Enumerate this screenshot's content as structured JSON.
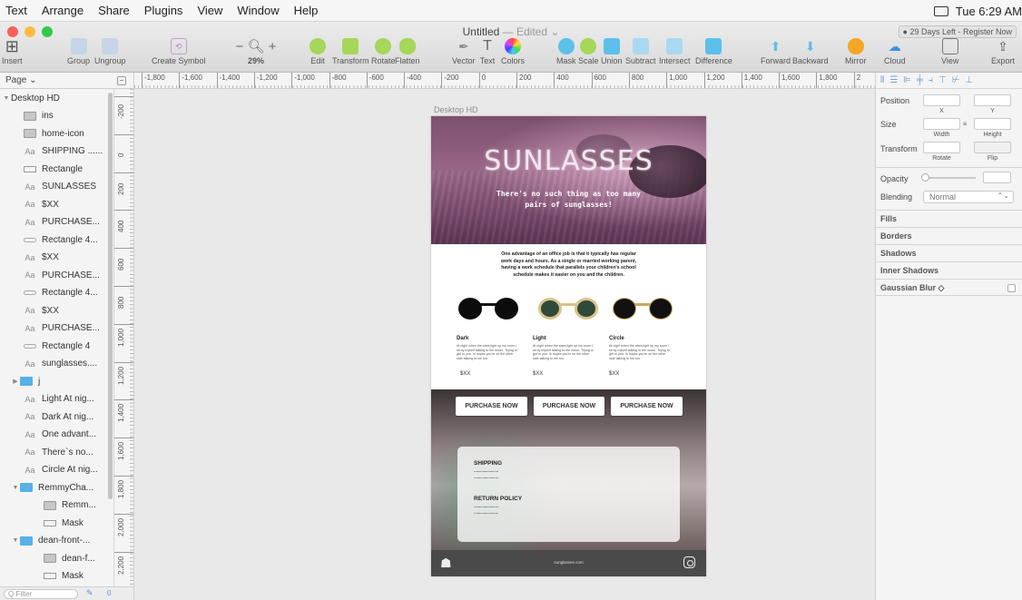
{
  "menubar": {
    "items": [
      "Text",
      "Arrange",
      "Share",
      "Plugins",
      "View",
      "Window",
      "Help"
    ],
    "clock": "Tue 6:29 AM"
  },
  "window": {
    "title": "Untitled",
    "edited": "— Edited ⌄",
    "trial": "● 29 Days Left - Register Now"
  },
  "toolbar": {
    "insert": "Insert",
    "group": "Group",
    "ungroup": "Ungroup",
    "create_symbol": "Create Symbol",
    "zoom": "29%",
    "edit": "Edit",
    "transform": "Transform",
    "rotate": "Rotate",
    "flatten": "Flatten",
    "vector": "Vector",
    "text": "Text",
    "colors": "Colors",
    "mask": "Mask",
    "scale": "Scale",
    "union": "Union",
    "subtract": "Subtract",
    "intersect": "Intersect",
    "difference": "Difference",
    "forward": "Forward",
    "backward": "Backward",
    "mirror": "Mirror",
    "cloud": "Cloud",
    "view": "View",
    "export": "Export",
    "zoom_minus": "−",
    "zoom_plus": "+",
    "text_glyph": "T"
  },
  "page_selector": "Page ⌄",
  "ruler": {
    "h_ticks": [
      "-1,800",
      "-1,600",
      "-1,400",
      "-1,200",
      "-1,000",
      "-800",
      "-600",
      "-400",
      "-200",
      "0",
      "200",
      "400",
      "600",
      "800",
      "1,000",
      "1,200",
      "1,400",
      "1,600",
      "1,800",
      "2"
    ],
    "v_ticks": [
      "-200",
      "0",
      "200",
      "400",
      "600",
      "800",
      "1,000",
      "1,200",
      "1,400",
      "1,600",
      "1,800",
      "2,000",
      "2,200"
    ]
  },
  "layers": [
    {
      "label": "Desktop HD",
      "icon": "artboard",
      "indent": 0,
      "tri": "▼"
    },
    {
      "label": "ins",
      "icon": "image",
      "indent": 1
    },
    {
      "label": "home-icon",
      "icon": "image",
      "indent": 1
    },
    {
      "label": "SHIPPING ......",
      "icon": "text",
      "indent": 1
    },
    {
      "label": "Rectangle",
      "icon": "rect",
      "indent": 1
    },
    {
      "label": "SUNLASSES",
      "icon": "text",
      "indent": 1
    },
    {
      "label": "$XX",
      "icon": "text",
      "indent": 1
    },
    {
      "label": "PURCHASE...",
      "icon": "text",
      "indent": 1
    },
    {
      "label": "Rectangle 4...",
      "icon": "rndrect",
      "indent": 1
    },
    {
      "label": "$XX",
      "icon": "text",
      "indent": 1
    },
    {
      "label": "PURCHASE...",
      "icon": "text",
      "indent": 1
    },
    {
      "label": "Rectangle 4...",
      "icon": "rndrect",
      "indent": 1
    },
    {
      "label": "$XX",
      "icon": "text",
      "indent": 1
    },
    {
      "label": "PURCHASE...",
      "icon": "text",
      "indent": 1
    },
    {
      "label": "Rectangle 4",
      "icon": "rndrect",
      "indent": 1
    },
    {
      "label": "sunglasses....",
      "icon": "text",
      "indent": 1
    },
    {
      "label": "j",
      "icon": "folder",
      "indent": 1,
      "tri": "▶"
    },
    {
      "label": "Light At nig...",
      "icon": "text",
      "indent": 1
    },
    {
      "label": "Dark At nig...",
      "icon": "text",
      "indent": 1
    },
    {
      "label": "One advant...",
      "icon": "text",
      "indent": 1
    },
    {
      "label": "There`s no...",
      "icon": "text",
      "indent": 1
    },
    {
      "label": "Circle At nig...",
      "icon": "text",
      "indent": 1
    },
    {
      "label": "RemmyCha...",
      "icon": "folder",
      "indent": 1,
      "tri": "▼"
    },
    {
      "label": "Remm...",
      "icon": "image",
      "indent": 2
    },
    {
      "label": "Mask",
      "icon": "rect",
      "indent": 2
    },
    {
      "label": "dean-front-...",
      "icon": "folder",
      "indent": 1,
      "tri": "▼"
    },
    {
      "label": "dean-f...",
      "icon": "image",
      "indent": 2
    },
    {
      "label": "Mask",
      "icon": "rect",
      "indent": 2
    }
  ],
  "filter": {
    "placeholder": "Q Filter",
    "count": "0"
  },
  "artboard": {
    "label": "Desktop HD",
    "hero_title": "SUNLASSES",
    "hero_sub": "There's no such thing as too many pairs of sunglasses!",
    "intro": "One advantage of an office job is that it typically has regular work days and hours. As a single or married working parent, having a work schedule that parallels your children's school schedule makes it easier on you and the children.",
    "products": [
      {
        "title": "Dark",
        "desc": "At night when the stars light up my room I sit by myself talking to the moon. Trying to get to you. In hopes you're on the other side talking to me too.",
        "price": "$XX",
        "frame": "#141414",
        "lens": "#0c0c0c"
      },
      {
        "title": "Light",
        "desc": "At night when the stars light up my room I sit by myself talking to the moon. Trying to get to you. In hopes you're on the other side talking to me too.",
        "price": "$XX",
        "frame": "#d9c28a",
        "lens": "#2f4a3a"
      },
      {
        "title": "Circle",
        "desc": "At night when the stars light up my room I sit by myself talking to the moon. Trying to get to you. In hopes you're on the other side talking to me too.",
        "price": "$XX",
        "frame": "#c9a860",
        "lens": "#111111"
      }
    ],
    "purchase_label": "PURCHASE NOW",
    "shipping_title": "SHIPPING",
    "shipping_dots": ".......................",
    "return_title": "RETURN POLICY",
    "return_dots": ".......................",
    "footer_site": "sunglasses.com"
  },
  "inspector": {
    "position": "Position",
    "x": "X",
    "y": "Y",
    "size": "Size",
    "width": "Width",
    "height": "Height",
    "transform": "Transform",
    "rotate": "Rotate",
    "flip": "Flip",
    "opacity": "Opacity",
    "blending": "Blending",
    "blend_value": "Normal",
    "sections": [
      "Fills",
      "Borders",
      "Shadows",
      "Inner Shadows",
      "Gaussian Blur ◇"
    ]
  }
}
